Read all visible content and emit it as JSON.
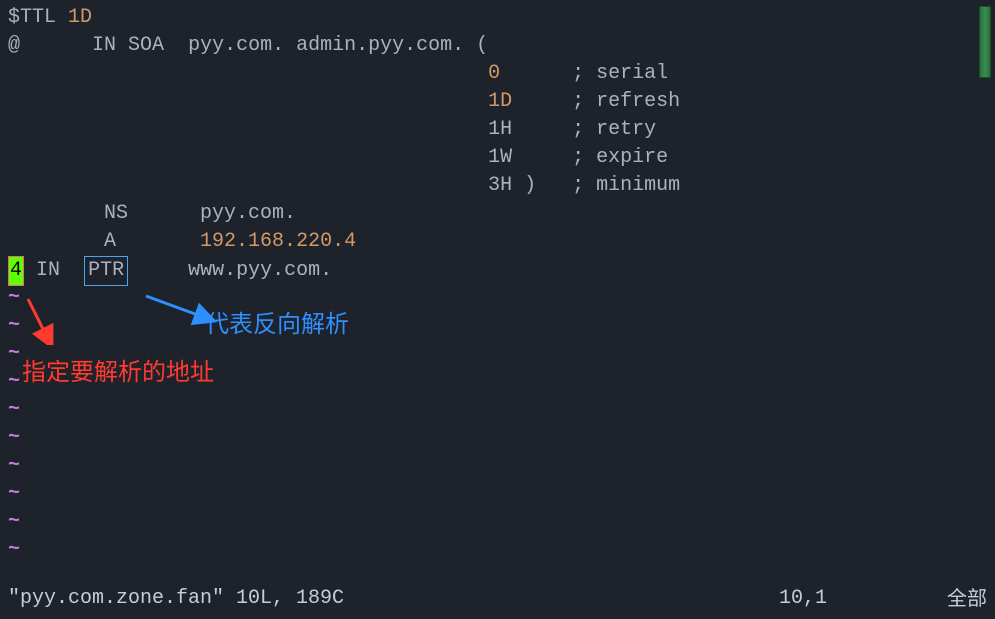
{
  "code": {
    "l1_ttl": "$TTL",
    "l1_val": "1D",
    "l2_at": "@",
    "l2_in": "IN SOA",
    "l2_dom": "pyy.com. admin.pyy.com. (",
    "l3_val": "0",
    "l3_cmt": "; serial",
    "l4_val": "1D",
    "l4_cmt": "; refresh",
    "l5_val": "1H",
    "l5_cmt": "; retry",
    "l6_val": "1W",
    "l6_cmt": "; expire",
    "l7_val": "3H )",
    "l7_cmt": "; minimum",
    "l8_ns": "NS",
    "l8_dom": "pyy.com.",
    "l9_a": "A",
    "l9_ip": "192.168.220.4",
    "l10_num": "4",
    "l10_in": "IN",
    "l10_ptr": "PTR",
    "l10_dom": "www.pyy.com."
  },
  "tilde": "~",
  "annotations": {
    "red_text": "指定要解析的地址",
    "blue_text": "代表反向解析"
  },
  "status": {
    "filename": "\"pyy.com.zone.fan\" 10L, 189C",
    "position": "10,1",
    "mode": "全部"
  }
}
